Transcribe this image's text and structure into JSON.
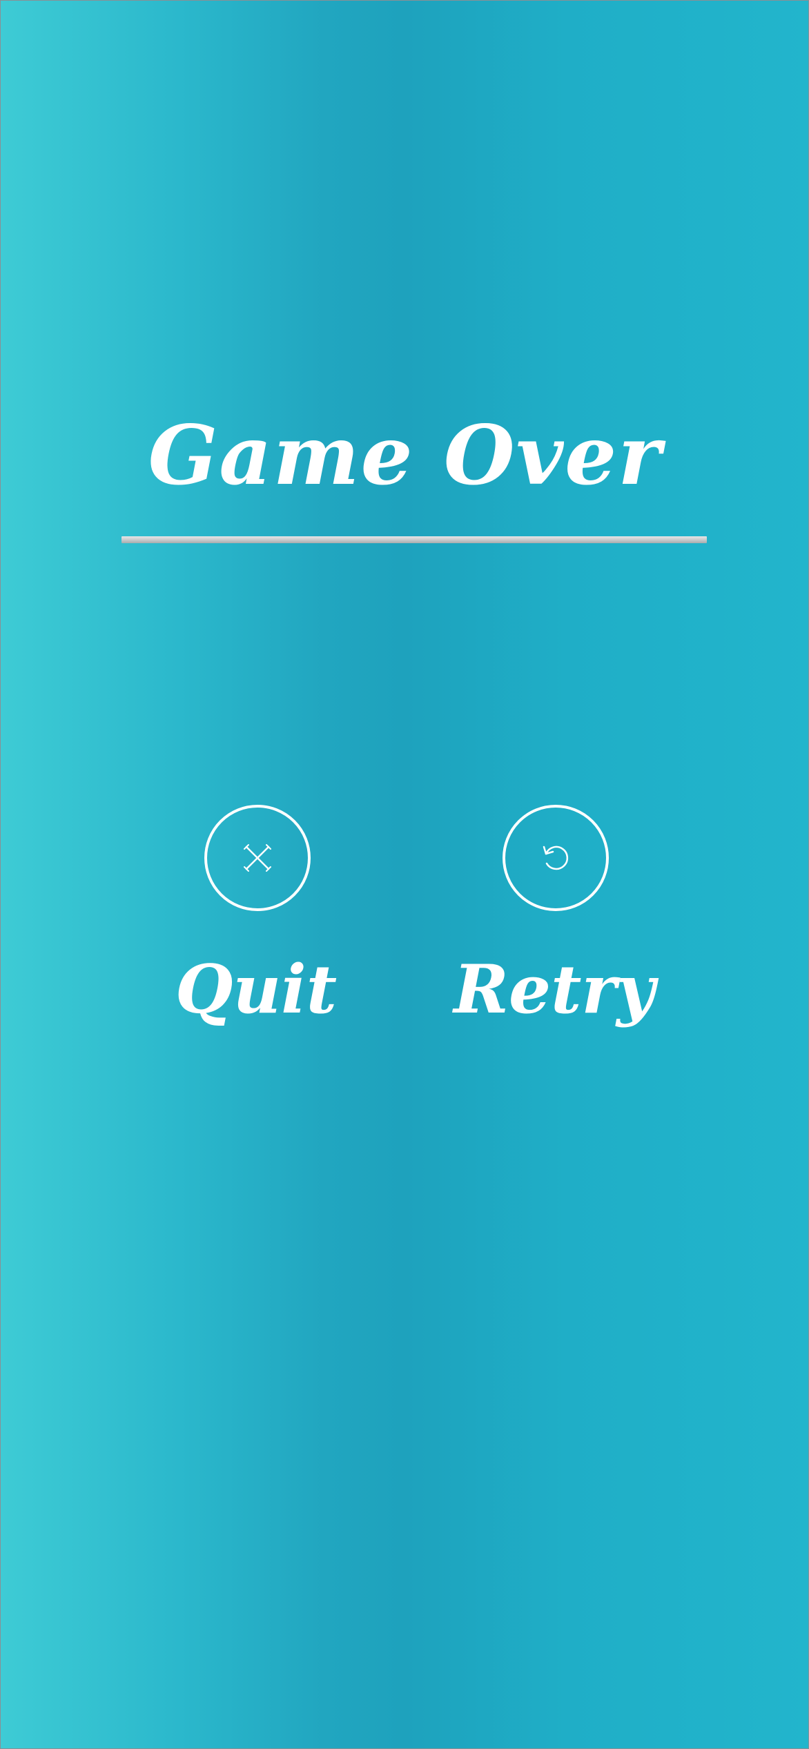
{
  "screen": {
    "title": "Game Over"
  },
  "actions": {
    "quit": {
      "label": "Quit",
      "icon": "close-icon"
    },
    "retry": {
      "label": "Retry",
      "icon": "refresh-icon"
    }
  },
  "colors": {
    "background_left": "#3ecbd5",
    "background_center": "#1ea2bd",
    "background_right": "#22b5cc",
    "text": "#ffffff",
    "divider": "#c4c7c9"
  }
}
